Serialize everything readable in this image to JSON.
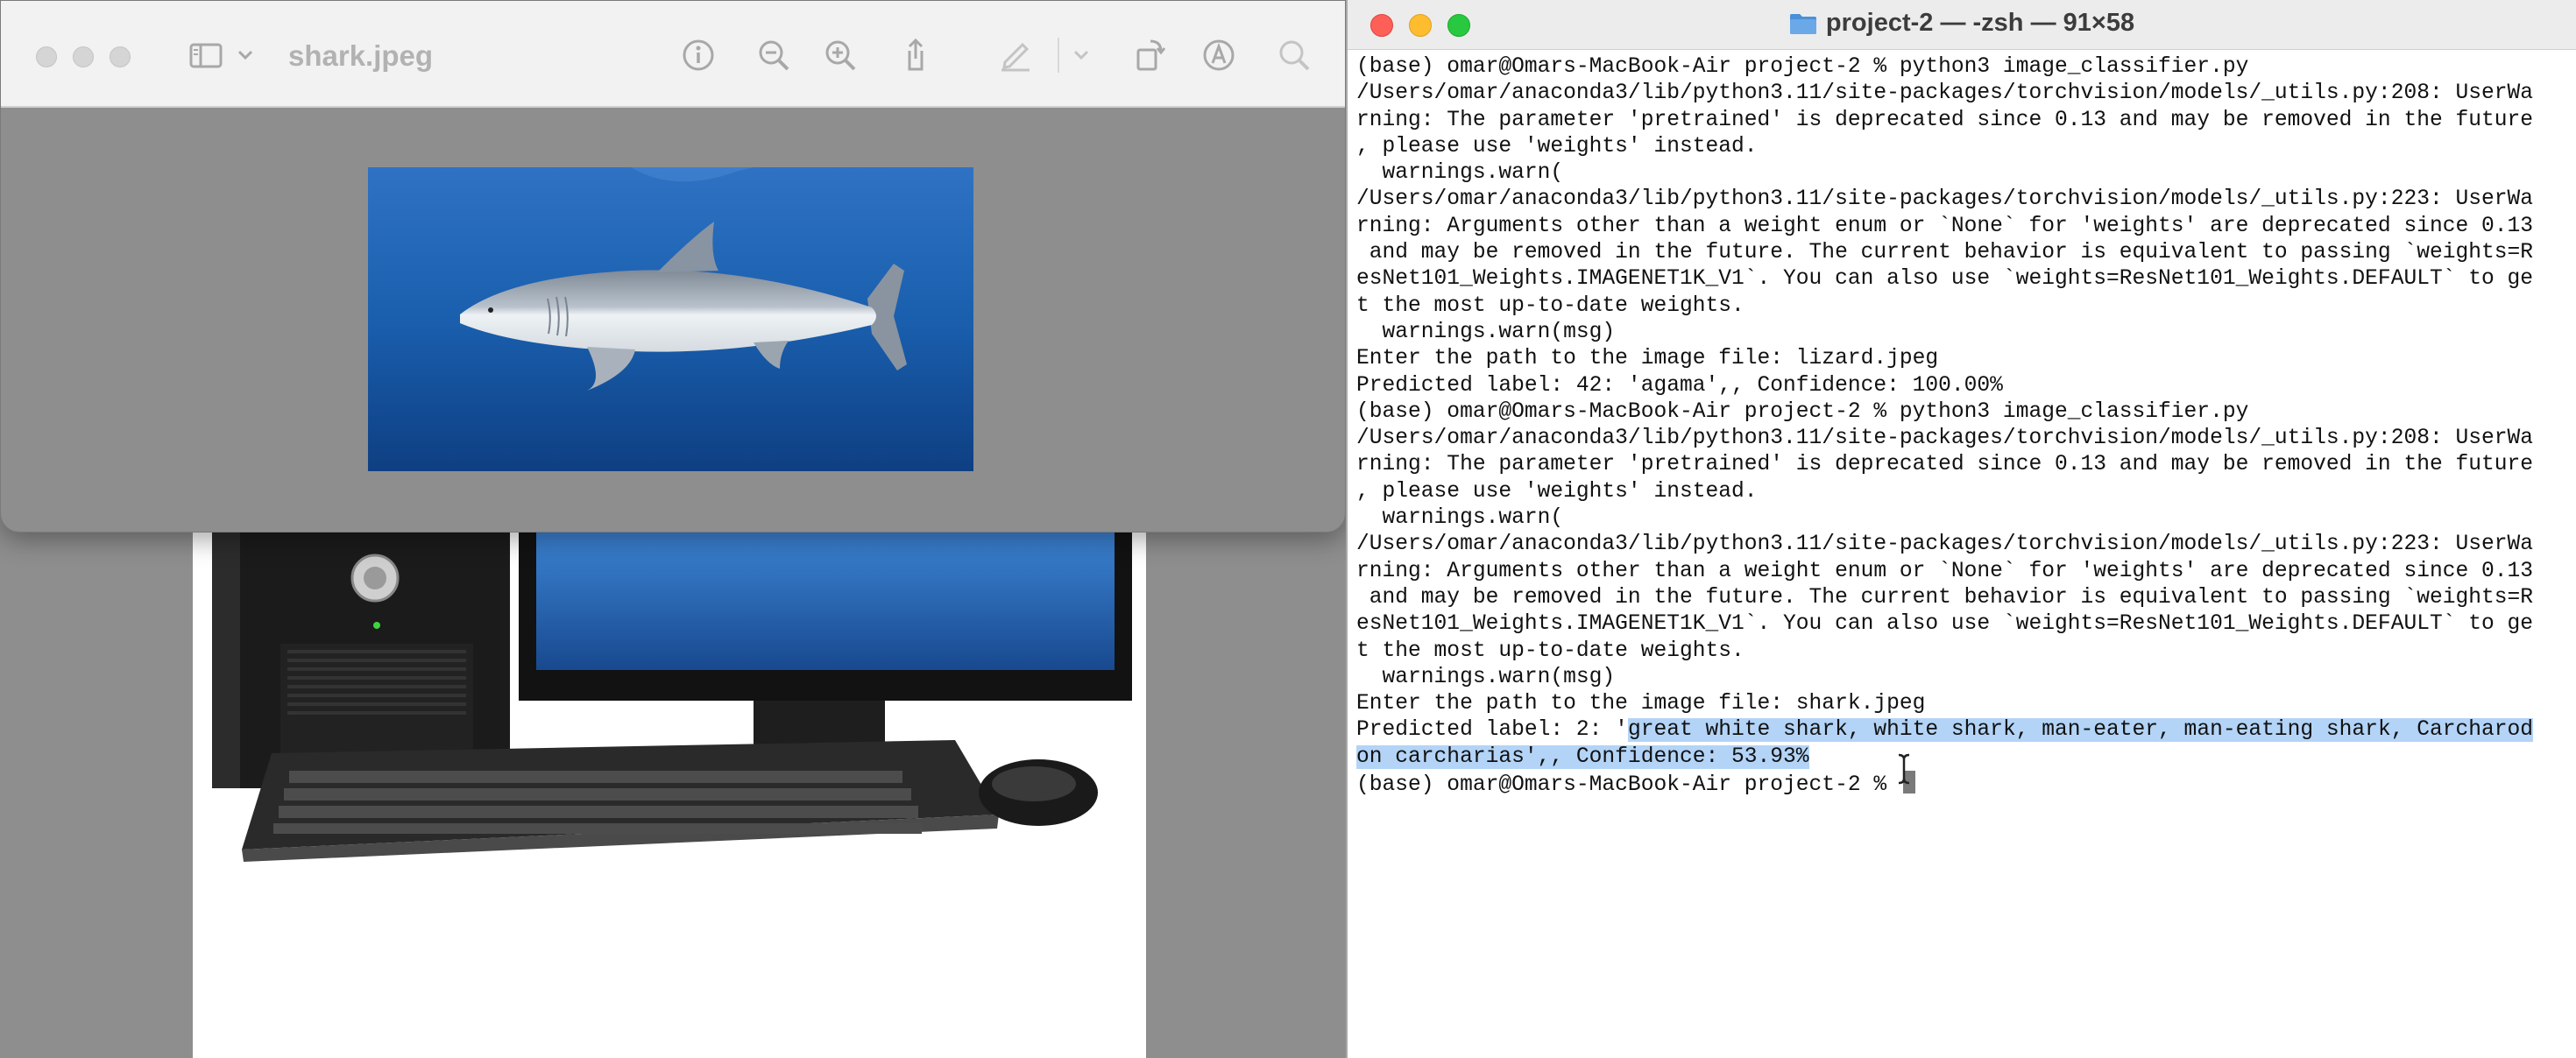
{
  "preview": {
    "title": "shark.jpeg",
    "icons": [
      "sidebar-icon",
      "chevron-down-icon",
      "info-icon",
      "zoom-out-icon",
      "zoom-in-icon",
      "share-icon",
      "markup-pen-icon",
      "chevron-down-icon",
      "rotate-icon",
      "markup-icon",
      "search-icon"
    ]
  },
  "terminal": {
    "title": "project-2 — -zsh — 91×58",
    "lines": [
      "(base) omar@Omars-MacBook-Air project-2 % python3 image_classifier.py",
      "/Users/omar/anaconda3/lib/python3.11/site-packages/torchvision/models/_utils.py:208: UserWa",
      "rning: The parameter 'pretrained' is deprecated since 0.13 and may be removed in the future",
      ", please use 'weights' instead.",
      "  warnings.warn(",
      "/Users/omar/anaconda3/lib/python3.11/site-packages/torchvision/models/_utils.py:223: UserWa",
      "rning: Arguments other than a weight enum or `None` for 'weights' are deprecated since 0.13",
      " and may be removed in the future. The current behavior is equivalent to passing `weights=R",
      "esNet101_Weights.IMAGENET1K_V1`. You can also use `weights=ResNet101_Weights.DEFAULT` to ge",
      "t the most up-to-date weights.",
      "  warnings.warn(msg)",
      "Enter the path to the image file: lizard.jpeg",
      "Predicted label: 42: 'agama',, Confidence: 100.00%",
      "(base) omar@Omars-MacBook-Air project-2 % python3 image_classifier.py",
      "/Users/omar/anaconda3/lib/python3.11/site-packages/torchvision/models/_utils.py:208: UserWa",
      "rning: The parameter 'pretrained' is deprecated since 0.13 and may be removed in the future",
      ", please use 'weights' instead.",
      "  warnings.warn(",
      "/Users/omar/anaconda3/lib/python3.11/site-packages/torchvision/models/_utils.py:223: UserWa",
      "rning: Arguments other than a weight enum or `None` for 'weights' are deprecated since 0.13",
      " and may be removed in the future. The current behavior is equivalent to passing `weights=R",
      "esNet101_Weights.IMAGENET1K_V1`. You can also use `weights=ResNet101_Weights.DEFAULT` to ge",
      "t the most up-to-date weights.",
      "  warnings.warn(msg)",
      "Enter the path to the image file: shark.jpeg"
    ],
    "result_line1_plain": "Predicted label: 2: '",
    "result_line1_selected": "great white shark, white shark, man-eater, man-eating shark, Carcharod",
    "result_line2_selected": "on carcharias',, Confidence: 53.93%",
    "prompt": "(base) omar@Omars-MacBook-Air project-2 % ",
    "selection_color": "#b3d4f7"
  },
  "colors": {
    "close": "#fe5f57",
    "minimize": "#febc2e",
    "zoom": "#28c840",
    "folder": "#4a90d9"
  }
}
